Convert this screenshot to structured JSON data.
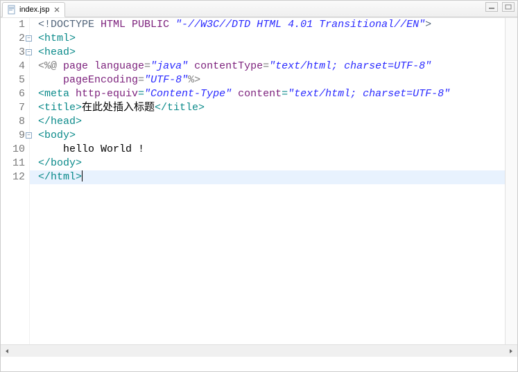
{
  "tab": {
    "filename": "index.jsp",
    "close_tooltip": "Close"
  },
  "window": {
    "minimize_tooltip": "Minimize",
    "maximize_tooltip": "Maximize"
  },
  "editor": {
    "current_line": 12,
    "lines": [
      {
        "num": "1",
        "fold": null,
        "tokens": [
          [
            "doctype",
            "<!DOCTYPE "
          ],
          [
            "keyword",
            "HTML "
          ],
          [
            "keyword",
            "PUBLIC "
          ],
          [
            "string",
            "\"-//W3C//DTD HTML 4.01 Transitional//EN\""
          ],
          [
            "doctype",
            ">"
          ]
        ]
      },
      {
        "num": "2",
        "fold": "minus",
        "tokens": [
          [
            "tag",
            "<html>"
          ]
        ]
      },
      {
        "num": "3",
        "fold": "minus",
        "tokens": [
          [
            "tag",
            "<head>"
          ]
        ]
      },
      {
        "num": "4",
        "fold": null,
        "tokens": [
          [
            "directive",
            "<%@ "
          ],
          [
            "attr",
            "page "
          ],
          [
            "keyword",
            "language"
          ],
          [
            "directive",
            "="
          ],
          [
            "string",
            "\"java\""
          ],
          [
            "directive",
            " "
          ],
          [
            "keyword",
            "contentType"
          ],
          [
            "directive",
            "="
          ],
          [
            "string",
            "\"text/html; charset=UTF-8\""
          ]
        ]
      },
      {
        "num": "5",
        "fold": null,
        "tokens": [
          [
            "directive",
            "    "
          ],
          [
            "keyword",
            "pageEncoding"
          ],
          [
            "directive",
            "="
          ],
          [
            "string",
            "\"UTF-8\""
          ],
          [
            "directive",
            "%>"
          ]
        ]
      },
      {
        "num": "6",
        "fold": null,
        "tokens": [
          [
            "tag",
            "<meta "
          ],
          [
            "keyword",
            "http-equiv"
          ],
          [
            "tag",
            "="
          ],
          [
            "string",
            "\"Content-Type\""
          ],
          [
            "tag",
            " "
          ],
          [
            "keyword",
            "content"
          ],
          [
            "tag",
            "="
          ],
          [
            "string",
            "\"text/html; charset=UTF-8\""
          ]
        ]
      },
      {
        "num": "7",
        "fold": null,
        "tokens": [
          [
            "tag",
            "<title>"
          ],
          [
            "text",
            "在此处插入标题"
          ],
          [
            "tag",
            "</title>"
          ]
        ]
      },
      {
        "num": "8",
        "fold": null,
        "tokens": [
          [
            "tag",
            "</head>"
          ]
        ]
      },
      {
        "num": "9",
        "fold": "minus",
        "tokens": [
          [
            "tag",
            "<body>"
          ]
        ]
      },
      {
        "num": "10",
        "fold": null,
        "tokens": [
          [
            "text",
            "    hello World !"
          ]
        ]
      },
      {
        "num": "11",
        "fold": null,
        "tokens": [
          [
            "tag",
            "</body>"
          ]
        ]
      },
      {
        "num": "12",
        "fold": null,
        "tokens": [
          [
            "tag",
            "</html>"
          ]
        ]
      }
    ]
  }
}
